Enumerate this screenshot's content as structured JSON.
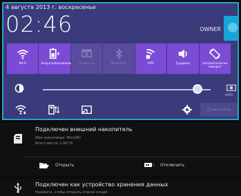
{
  "status_bar": {
    "date": "4 августа 2013 г. воскресенье"
  },
  "quick_settings": {
    "time": "02:46",
    "user_name": "OWNER",
    "toggles": [
      {
        "label": "Wi-Fi",
        "icon": "wifi-icon",
        "state": "on"
      },
      {
        "label": "Энергосбережение",
        "icon": "battery-saver-icon",
        "state": "on"
      },
      {
        "label": "Опоясать",
        "icon": "ring-icon",
        "state": "off"
      },
      {
        "label": "Bluetooth",
        "icon": "bluetooth-icon",
        "state": "off"
      },
      {
        "label": "GPS",
        "icon": "gps-icon",
        "state": "on"
      },
      {
        "label": "Сурдина",
        "icon": "mute-icon",
        "state": "on"
      },
      {
        "label": "Автоматически поворот",
        "icon": "rotate-icon",
        "state": "on"
      }
    ],
    "brightness": {
      "level": 0.92,
      "auto_label": "AUTO"
    },
    "clear_label": "Очистить"
  },
  "notifications": [
    {
      "title": "Подключен внешний накопитель",
      "lines": [
        "Имя хранилища: MicroSD",
        "Всего места: 1,90 ГБ"
      ],
      "actions": [
        {
          "label": "Открыть",
          "icon": "folder-open-icon"
        },
        {
          "label": "Отключить",
          "icon": "eject-card-icon"
        }
      ]
    },
    {
      "title": "Подключен как устройство хранения данных",
      "lines": [
        "Нажмите, чтобы открыть список опций"
      ]
    }
  ],
  "colors": {
    "panel_bg": "#3b3a7a",
    "toggle_on": "#7c4bd6",
    "toggle_off": "#5b4b9e",
    "accent": "#24a6d2"
  }
}
